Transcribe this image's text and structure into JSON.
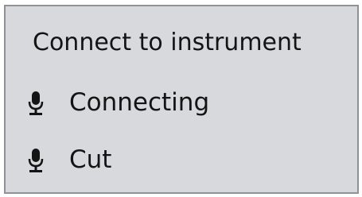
{
  "menu": {
    "header": "Connect to instrument",
    "items": [
      {
        "icon": "microphone-icon",
        "label": "Connecting"
      },
      {
        "icon": "microphone-icon",
        "label": "Cut"
      }
    ]
  },
  "colors": {
    "menu_background": "#d7d9dc",
    "menu_border": "#8f9296",
    "text": "#141414"
  }
}
